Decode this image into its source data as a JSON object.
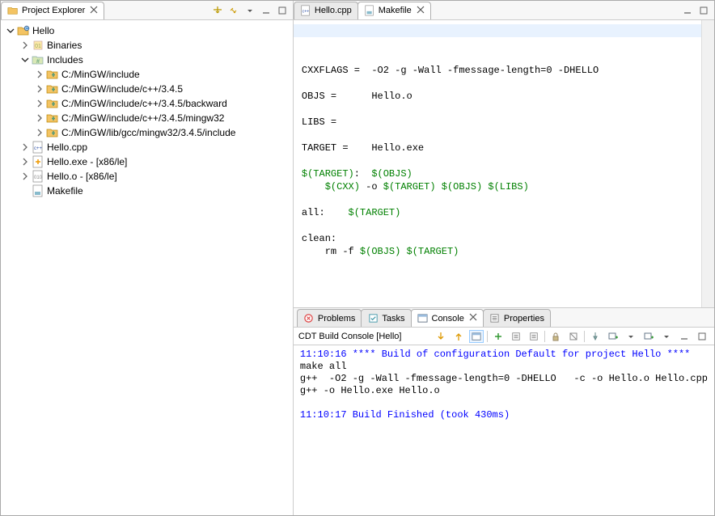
{
  "explorer": {
    "title": "Project Explorer",
    "tree": [
      {
        "level": 0,
        "exp": "v",
        "icon": "proj",
        "label": "Hello"
      },
      {
        "level": 1,
        "exp": ">",
        "icon": "bin",
        "label": "Binaries"
      },
      {
        "level": 1,
        "exp": "v",
        "icon": "inc",
        "label": "Includes"
      },
      {
        "level": 2,
        "exp": ">",
        "icon": "incfld",
        "label": "C:/MinGW/include"
      },
      {
        "level": 2,
        "exp": ">",
        "icon": "incfld",
        "label": "C:/MinGW/include/c++/3.4.5"
      },
      {
        "level": 2,
        "exp": ">",
        "icon": "incfld",
        "label": "C:/MinGW/include/c++/3.4.5/backward"
      },
      {
        "level": 2,
        "exp": ">",
        "icon": "incfld",
        "label": "C:/MinGW/include/c++/3.4.5/mingw32"
      },
      {
        "level": 2,
        "exp": ">",
        "icon": "incfld",
        "label": "C:/MinGW/lib/gcc/mingw32/3.4.5/include"
      },
      {
        "level": 1,
        "exp": ">",
        "icon": "cpp",
        "label": "Hello.cpp"
      },
      {
        "level": 1,
        "exp": ">",
        "icon": "exe",
        "label": "Hello.exe - [x86/le]"
      },
      {
        "level": 1,
        "exp": ">",
        "icon": "obj",
        "label": "Hello.o - [x86/le]"
      },
      {
        "level": 1,
        "exp": "",
        "icon": "mk",
        "label": "Makefile"
      }
    ]
  },
  "editors": {
    "tabs": [
      {
        "icon": "cpp",
        "label": "Hello.cpp",
        "active": false
      },
      {
        "icon": "mk",
        "label": "Makefile",
        "active": true
      }
    ],
    "lines": [
      {
        "t": "CXXFLAGS =  -O2 -g -Wall -fmessage-length=0 -DHELLO"
      },
      {
        "t": ""
      },
      {
        "t": "OBJS =      Hello.o"
      },
      {
        "t": ""
      },
      {
        "t": "LIBS ="
      },
      {
        "t": ""
      },
      {
        "t": "TARGET =    Hello.exe"
      },
      {
        "t": ""
      },
      {
        "p": [
          {
            "c": "green",
            "t": "$(TARGET)"
          },
          {
            "t": ":  "
          },
          {
            "c": "green",
            "t": "$(OBJS)"
          }
        ]
      },
      {
        "p": [
          {
            "t": "    "
          },
          {
            "c": "green",
            "t": "$(CXX)"
          },
          {
            "t": " -o "
          },
          {
            "c": "green",
            "t": "$(TARGET) $(OBJS) $(LIBS)"
          }
        ]
      },
      {
        "t": ""
      },
      {
        "p": [
          {
            "t": "all:    "
          },
          {
            "c": "green",
            "t": "$(TARGET)"
          }
        ]
      },
      {
        "t": ""
      },
      {
        "t": "clean:"
      },
      {
        "p": [
          {
            "t": "    rm -f "
          },
          {
            "c": "green",
            "t": "$(OBJS) $(TARGET)"
          }
        ]
      }
    ]
  },
  "bottom": {
    "tabs": [
      {
        "icon": "prob",
        "label": "Problems"
      },
      {
        "icon": "task",
        "label": "Tasks"
      },
      {
        "icon": "cons",
        "label": "Console",
        "active": true
      },
      {
        "icon": "prop",
        "label": "Properties"
      }
    ],
    "subtitle": "CDT Build Console [Hello]",
    "lines": [
      {
        "c": "blue",
        "t": "11:10:16 **** Build of configuration Default for project Hello ****"
      },
      {
        "t": "make all "
      },
      {
        "t": "g++  -O2 -g -Wall -fmessage-length=0 -DHELLO   -c -o Hello.o Hello.cpp"
      },
      {
        "t": "g++ -o Hello.exe Hello.o"
      },
      {
        "t": ""
      },
      {
        "c": "blue",
        "t": "11:10:17 Build Finished (took 430ms)"
      }
    ]
  }
}
